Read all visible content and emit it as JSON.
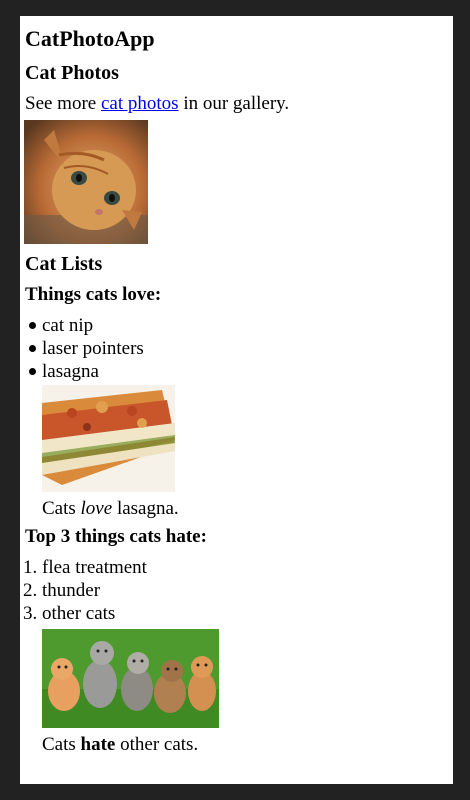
{
  "app": {
    "title": "CatPhotoApp"
  },
  "photos_section": {
    "heading": "Cat Photos",
    "intro_before": "See more ",
    "intro_link": "cat photos",
    "intro_after": " in our gallery."
  },
  "lists_section": {
    "heading": "Cat Lists",
    "love": {
      "heading": "Things cats love:",
      "items": [
        "cat nip",
        "laser pointers",
        "lasagna"
      ],
      "caption_before": "Cats ",
      "caption_emphasis": "love",
      "caption_after": " lasagna."
    },
    "hate": {
      "heading": "Top 3 things cats hate:",
      "items": [
        "flea treatment",
        "thunder",
        "other cats"
      ],
      "numbers": [
        "1.",
        "2.",
        "3."
      ],
      "caption_before": "Cats ",
      "caption_emphasis": "hate",
      "caption_after": " other cats."
    }
  }
}
